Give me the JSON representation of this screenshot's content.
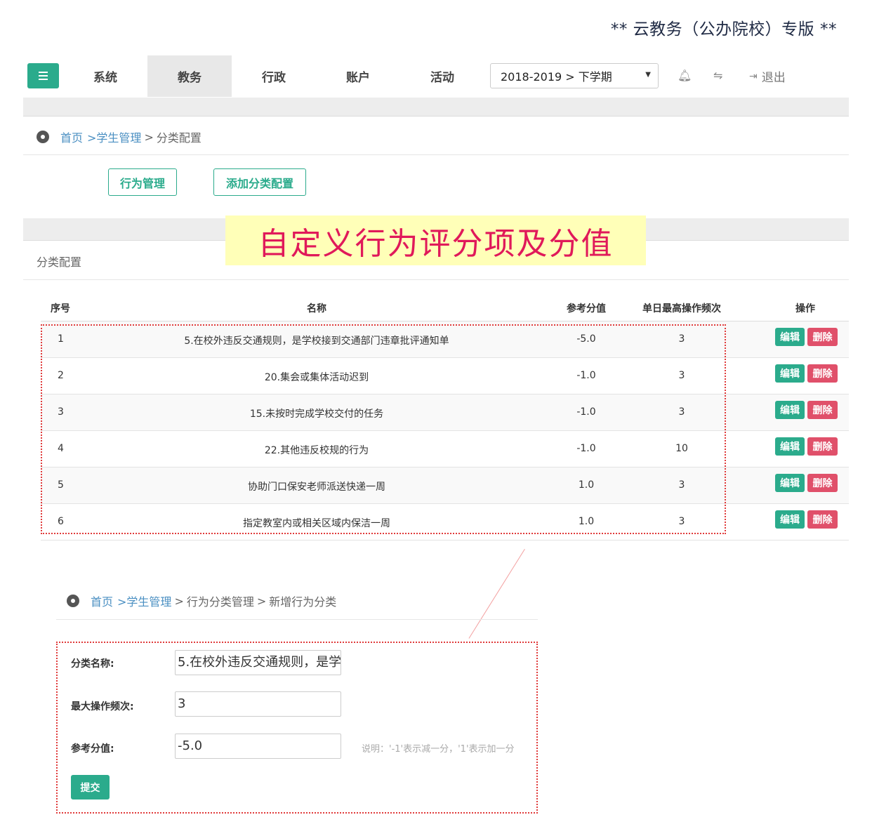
{
  "brand_note": "** 云教务（公办院校）专版 **",
  "nav": {
    "tabs": [
      "系统",
      "教务",
      "行政",
      "账户",
      "活动"
    ],
    "term": "2018-2019 > 下学期",
    "logout": "退出"
  },
  "breadcrumb1": {
    "home": "首页",
    "student": ">学生管理",
    "sep": ">",
    "current": "分类配置"
  },
  "buttons": {
    "behavior_mgmt": "行为管理",
    "add_config": "添加分类配置"
  },
  "banner": "自定义行为评分项及分值",
  "section_title": "分类配置",
  "table": {
    "headers": {
      "idx": "序号",
      "name": "名称",
      "score": "参考分值",
      "freq": "单日最高操作频次",
      "action": "操作"
    },
    "edit_label": "编辑",
    "delete_label": "删除",
    "rows": [
      {
        "idx": "1",
        "name": "5.在校外违反交通规则，是学校接到交通部门违章批评通知单",
        "score": "-5.0",
        "freq": "3"
      },
      {
        "idx": "2",
        "name": "20.集会或集体活动迟到",
        "score": "-1.0",
        "freq": "3"
      },
      {
        "idx": "3",
        "name": "15.未按时完成学校交付的任务",
        "score": "-1.0",
        "freq": "3"
      },
      {
        "idx": "4",
        "name": "22.其他违反校规的行为",
        "score": "-1.0",
        "freq": "10"
      },
      {
        "idx": "5",
        "name": "协助门口保安老师派送快递一周",
        "score": "1.0",
        "freq": "3"
      },
      {
        "idx": "6",
        "name": "指定教室内或相关区域内保洁一周",
        "score": "1.0",
        "freq": "3"
      }
    ]
  },
  "breadcrumb2": {
    "home": "首页",
    "student": ">学生管理",
    "sep1": ">",
    "category": "行为分类管理",
    "sep2": ">",
    "current": "新增行为分类"
  },
  "form": {
    "name_label": "分类名称:",
    "name_value": "5.在校外违反交通规则，是学",
    "freq_label": "最大操作频次:",
    "freq_value": "3",
    "score_label": "参考分值:",
    "score_value": "-5.0",
    "hint": "说明：'-1'表示减一分，'1'表示加一分",
    "submit": "提交"
  },
  "colors": {
    "accent": "#2bab8c",
    "danger": "#e0506a",
    "banner_bg": "#ffffb8",
    "banner_text": "#e0195a",
    "link": "#4a8fc2"
  }
}
